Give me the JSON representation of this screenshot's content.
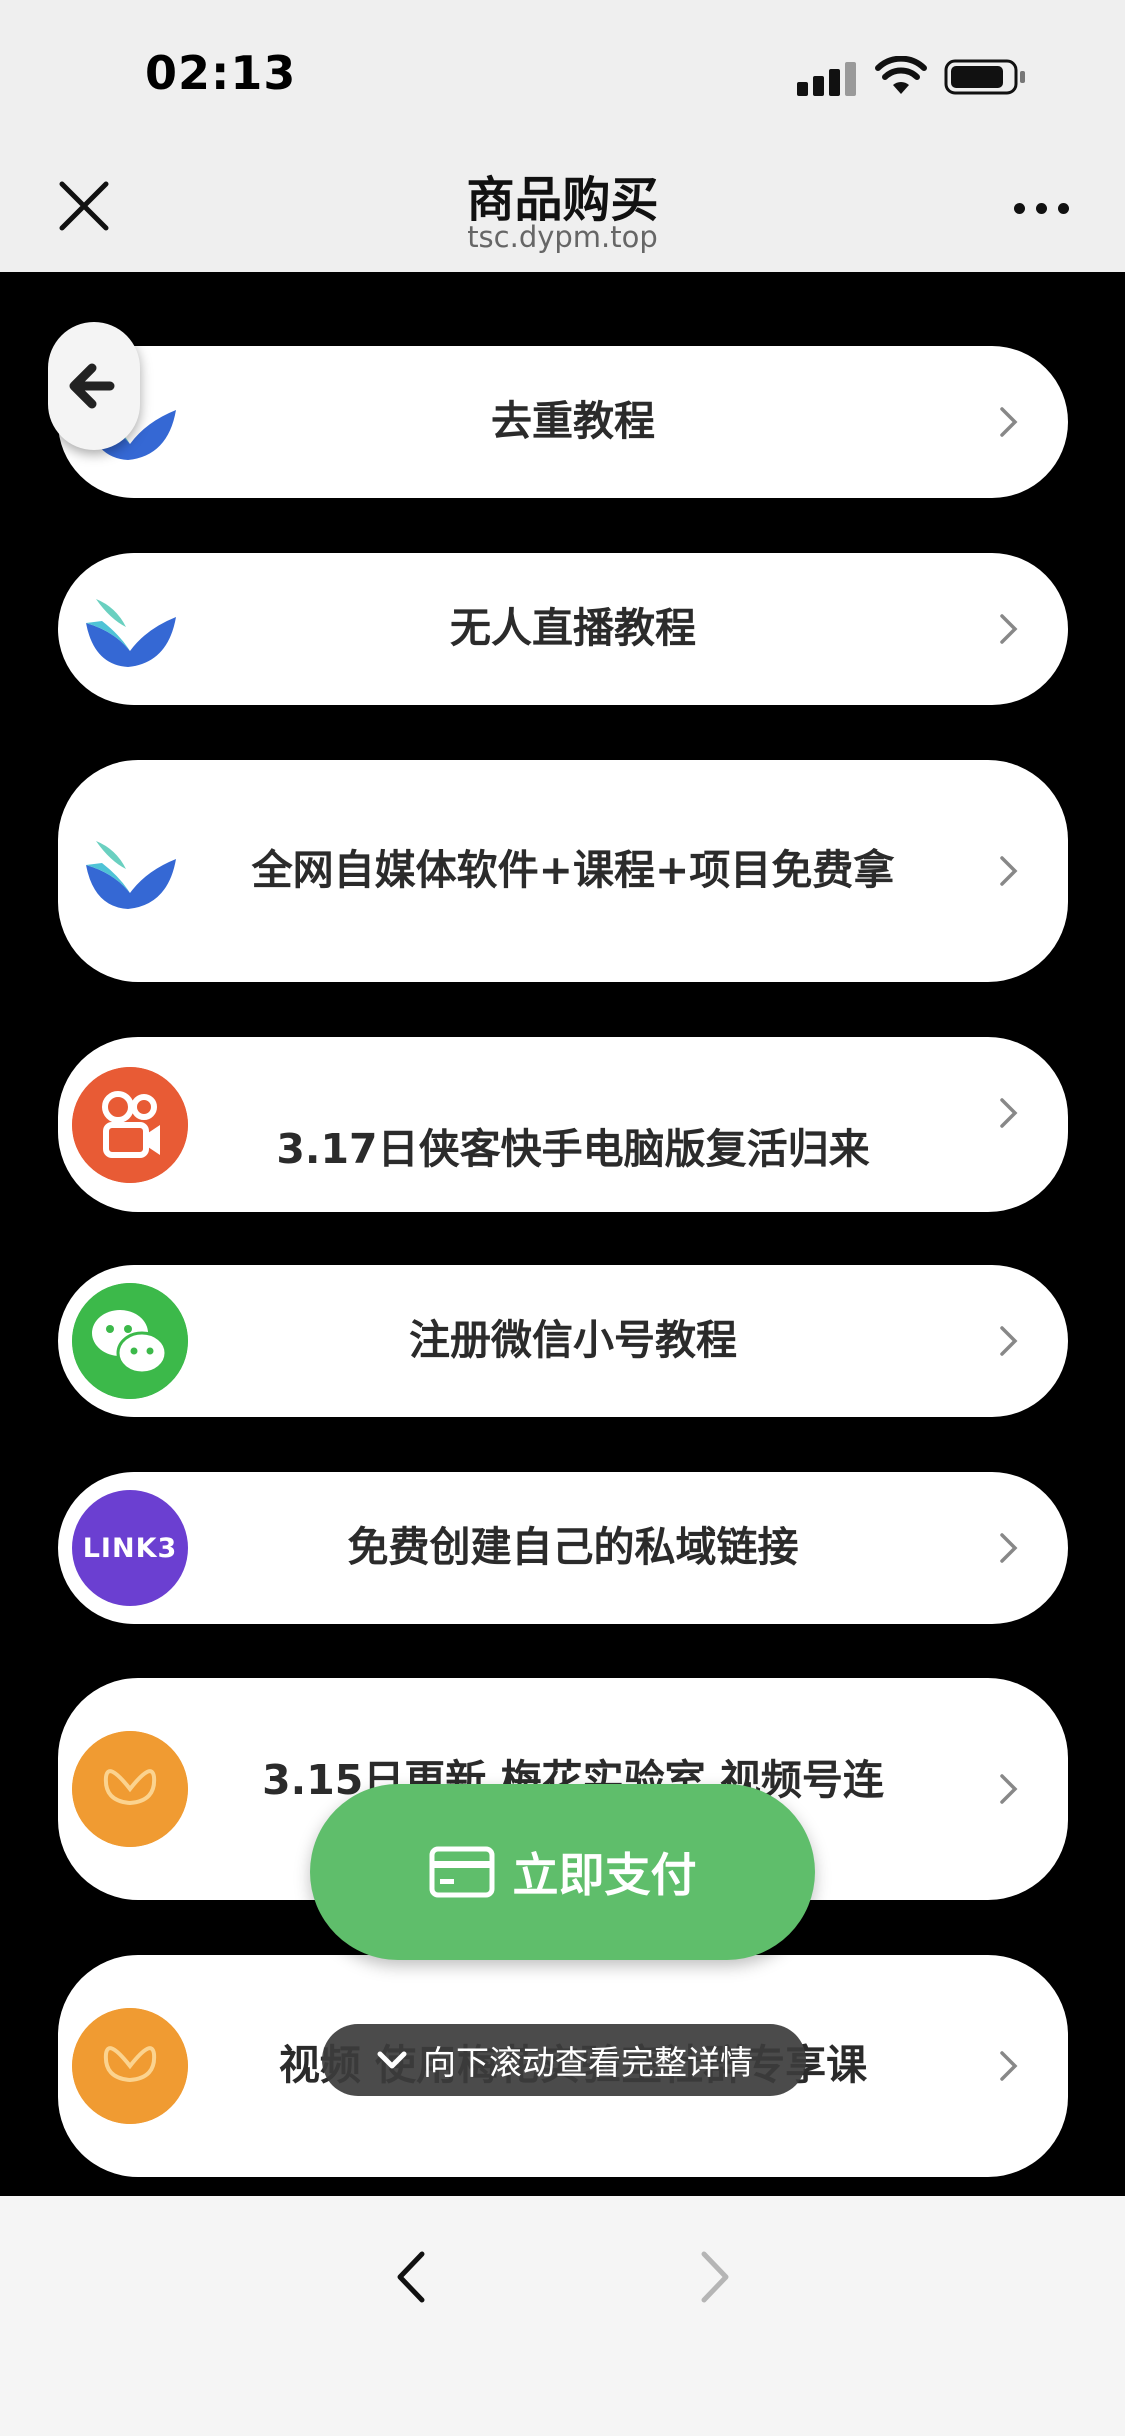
{
  "status_bar": {
    "time": "02:13"
  },
  "header": {
    "title": "商品购买",
    "domain": "tsc.dypm.top"
  },
  "items": [
    {
      "label": "去重教程",
      "icon": "bird-logo-icon"
    },
    {
      "label": "无人直播教程",
      "icon": "bird-logo-icon"
    },
    {
      "label": "全网自媒体软件+课程+项目免费拿",
      "icon": "bird-logo-icon"
    },
    {
      "label": "3.17日侠客快手电脑版复活归来",
      "icon": "kuaishou-icon"
    },
    {
      "label": "注册微信小号教程",
      "icon": "wechat-icon"
    },
    {
      "label": "免费创建自己的私域链接",
      "icon": "link3-icon",
      "icon_text": "LINK3"
    },
    {
      "label": "3.15日更新 梅花实验室 视频号连",
      "icon": "butterfly-icon"
    },
    {
      "label": "视频 使用梅花实验室社群专享课",
      "icon": "butterfly-icon"
    }
  ],
  "pay_button": {
    "label": "立即支付"
  },
  "scroll_hint": {
    "label": "向下滚动查看完整详情"
  },
  "colors": {
    "pay_green": "#5fbe6b",
    "kuaishou": "#e85b35",
    "wechat": "#3cb94a",
    "link3": "#6b3fd1",
    "meihua": "#f09b32"
  }
}
